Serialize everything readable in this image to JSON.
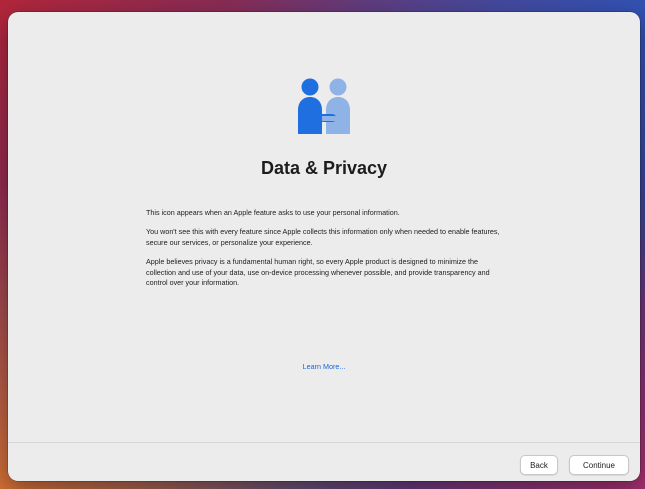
{
  "dialog": {
    "title": "Data & Privacy",
    "paragraphs": [
      "This icon appears when an Apple feature asks to use your personal information.",
      "You won't see this with every feature since Apple collects this information only when needed to enable features, secure our services, or personalize your experience.",
      "Apple believes privacy is a fundamental human right, so every Apple product is designed to minimize the collection and use of your data, use on-device processing whenever possible, and provide transparency and control over your information."
    ],
    "learn_more": "Learn More..."
  },
  "footer": {
    "back_label": "Back",
    "continue_label": "Continue"
  },
  "icon": {
    "name": "data-privacy-handshake-icon",
    "color_primary": "#1f6fe0",
    "color_secondary": "#8fb3e6"
  },
  "colors": {
    "window_bg": "#ececec",
    "link": "#1a64d8",
    "text": "#1d1d1f"
  }
}
